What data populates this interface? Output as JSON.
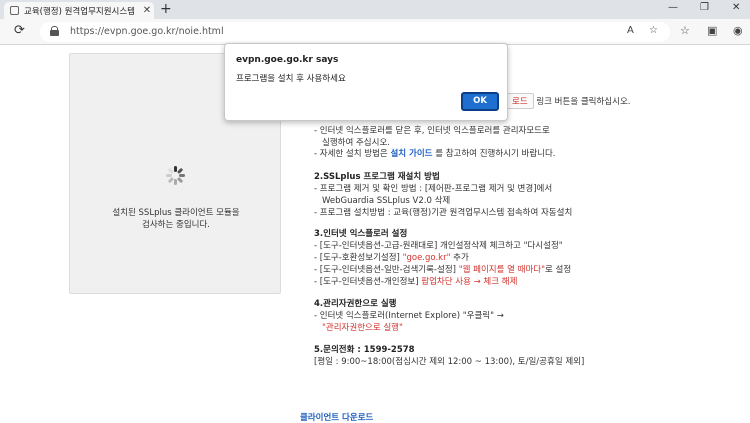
{
  "browser": {
    "tab_title": "교육(행정) 원격업무지원시스템",
    "tab_close_glyph": "✕",
    "new_tab_glyph": "+",
    "url": "https://evpn.goe.go.kr/noie.html",
    "window_controls": [
      "—",
      "❐",
      "✕"
    ]
  },
  "left_panel": {
    "checking_text_line1": "설치된 SSLplus 클라이언트 모듈을",
    "checking_text_line2": "검사하는 중입니다."
  },
  "content": {
    "line_top_btn": "로드",
    "line_top_rest": "링크 버튼을 클릭하십시오.",
    "s1_l1": "- 인터넷 익스플로러를 닫은 후, 인터넷 익스플로러를 관리자모드로",
    "s1_l2": "실행하여 주십시오.",
    "s1_l3_pre": "- 자세한 설치 방법은 ",
    "s1_l3_link": "설치 가이드",
    "s1_l3_post": " 를 참고하여 진행하시기 바랍니다.",
    "s2_title": "2.SSLplus 프로그램 재설치 방법",
    "s2_l1": "- 프로그램 제거 및 확인 방법 : [제어판-프로그램 제거 및 변경]에서",
    "s2_l2": "WebGuardia SSLplus V2.0 삭제",
    "s2_l3": "- 프로그램 설치방법 : 교육(행정)기관 원격업무시스템 접속하여 자동설치",
    "s3_title": "3.인터넷 익스플로러 설정",
    "s3_l1": "- [도구-인터넷옵션-고급-원래대로] 개인설정삭제 체크하고 \"다시설정\"",
    "s3_l2_pre": "- [도구-호환성보기설정] ",
    "s3_l2_red": "\"goe.go.kr\"",
    "s3_l2_post": " 추가",
    "s3_l3_pre": "- [도구-인터넷옵션-일반-검색기록-설정] ",
    "s3_l3_red": "\"웹 페이지를 열 때마다\"",
    "s3_l3_post": "로 설정",
    "s3_l4_pre": "- [도구-인터넷옵션-개인정보] ",
    "s3_l4_red": "팝업차단 사용 → 체크 해제",
    "s4_title": "4.관리자권한으로 실행",
    "s4_l1": "- 인터넷 익스플로러(Internet Explore) \"우클릭\" →",
    "s4_l2": "\"관리자권한으로 실행\"",
    "s5_title": "5.문의전화 : 1599-2578",
    "s5_l1": "[평일 : 9:00~18:00(점심시간 제외 12:00 ~ 13:00), 토/일/공휴일 제외]",
    "client_download": "클라이언트 다운로드"
  },
  "dialog": {
    "title": "evpn.goe.go.kr says",
    "message": "프로그램을 설치 후 사용하세요",
    "ok_label": "OK"
  },
  "colors": {
    "ok_button": "#1f6fd0",
    "link_blue": "#1f5fbf",
    "warning_red": "#d2322d"
  }
}
